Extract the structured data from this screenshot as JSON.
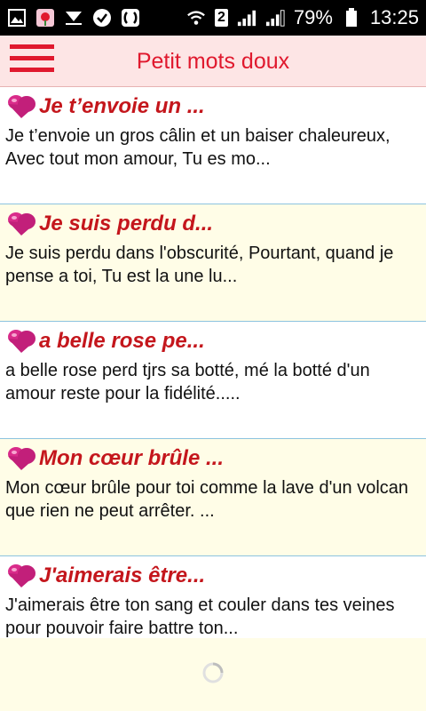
{
  "status_bar": {
    "battery": "79%",
    "time": "13:25",
    "sim": "2",
    "icons": [
      "gallery-icon",
      "flower-app-icon",
      "download-icon",
      "check-icon",
      "app-icon",
      "wifi-icon",
      "signal-icon",
      "signal-icon",
      "battery-icon"
    ]
  },
  "app_bar": {
    "title": "Petit mots doux",
    "menu_icon": "hamburger-menu-icon",
    "accent": "#e0192e"
  },
  "messages": [
    {
      "title": "Je t’envoie un ...",
      "body": "Je t’envoie un gros câlin et un baiser chaleureux, Avec tout mon amour, Tu es mo..."
    },
    {
      "title": "Je suis perdu d...",
      "body": "Je suis perdu dans l'obscurité, Pourtant, quand je pense a toi, Tu est la une lu..."
    },
    {
      "title": "a belle rose pe...",
      "body": "a belle rose perd tjrs sa botté, mé la botté d'un amour reste pour la fidélité....."
    },
    {
      "title": "Mon cœur brûle ...",
      "body": "Mon cœur brûle pour toi comme la lave d'un volcan que rien ne peut arrêter. ..."
    },
    {
      "title": "J'aimerais être...",
      "body": "J'aimerais être ton sang et couler dans tes veines pour pouvoir faire battre ton..."
    }
  ],
  "loader_icon": "spinner-icon"
}
